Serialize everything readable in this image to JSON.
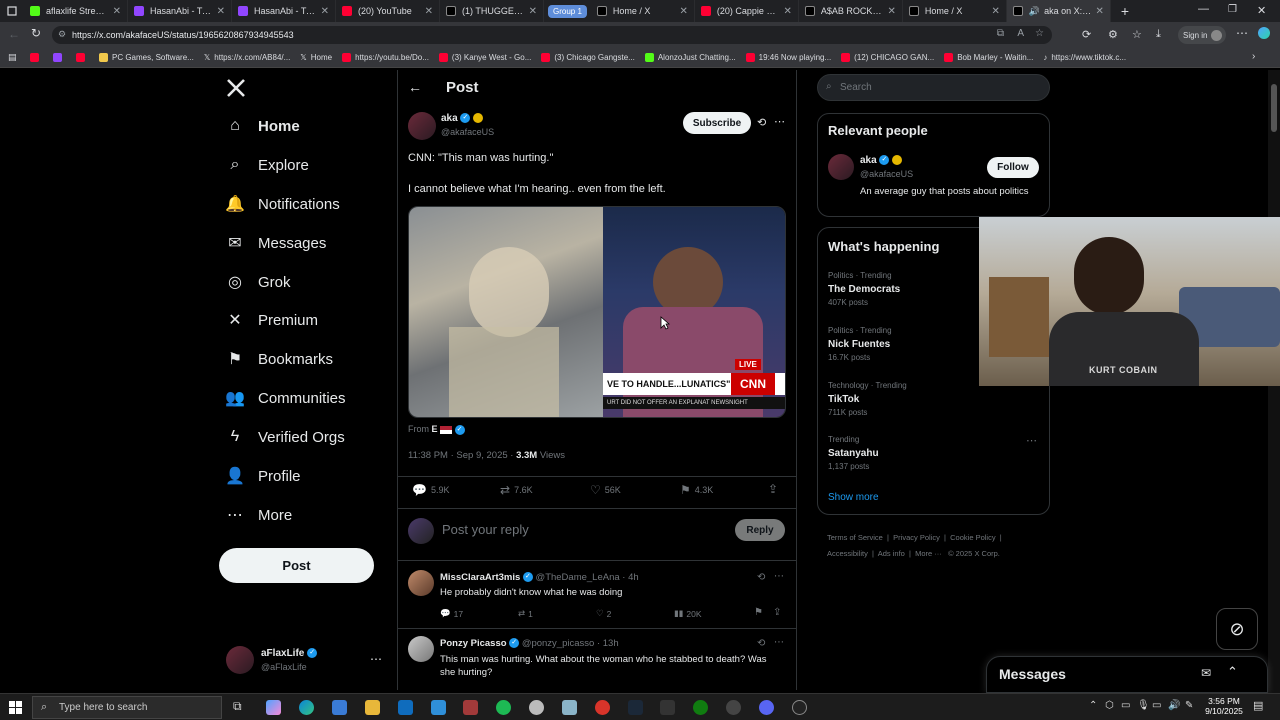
{
  "browser": {
    "tabs": [
      {
        "title": "aflaxlife Stream - V",
        "color": "#53fc18"
      },
      {
        "title": "HasanAbi - Twitch",
        "color": "#9146ff"
      },
      {
        "title": "HasanAbi - Twitch",
        "color": "#9146ff"
      },
      {
        "title": "(20) YouTube",
        "color": "#ff0033"
      },
      {
        "title": "(1) THUGGERDAIL",
        "color": "#e7e9ea"
      },
      {
        "title": "Home / X",
        "color": "#e7e9ea"
      },
      {
        "title": "(20) Cappie Ponde",
        "color": "#ff0033"
      },
      {
        "title": "A$AB ROCKY on X",
        "color": "#e7e9ea"
      },
      {
        "title": "Home / X",
        "color": "#e7e9ea"
      },
      {
        "title": "aka on X: \"CN",
        "color": "#e7e9ea"
      }
    ],
    "group_label": "Group 1",
    "url": "https://x.com/akafaceUS/status/1965620867934945543",
    "sign_in": "Sign in",
    "bookmarks": [
      {
        "label": "",
        "color": "#ff0033"
      },
      {
        "label": "",
        "color": "#9146ff"
      },
      {
        "label": "",
        "color": "#ff0033"
      },
      {
        "label": "PC Games, Software...",
        "color": "#f2c94c"
      },
      {
        "label": "https://x.com/AB84/...",
        "color": "#e7e9ea"
      },
      {
        "label": "Home",
        "color": "#e7e9ea"
      },
      {
        "label": "https://youtu.be/Do...",
        "color": "#ff0033"
      },
      {
        "label": "(3) Kanye West - Go...",
        "color": "#ff0033"
      },
      {
        "label": "(3) Chicago Gangste...",
        "color": "#ff0033"
      },
      {
        "label": "AlonzoJust Chatting...",
        "color": "#53fc18"
      },
      {
        "label": "19:46 Now playing...",
        "color": "#ff0033"
      },
      {
        "label": "(12) CHICAGO GAN...",
        "color": "#ff0033"
      },
      {
        "label": "Bob Marley - Waitin...",
        "color": "#ff0033"
      },
      {
        "label": "https://www.tiktok.c...",
        "color": "#e7e9ea"
      }
    ]
  },
  "nav": {
    "items": [
      {
        "label": "Home",
        "icon": "⌂"
      },
      {
        "label": "Explore",
        "icon": "⌕"
      },
      {
        "label": "Notifications",
        "icon": "🔔"
      },
      {
        "label": "Messages",
        "icon": "✉"
      },
      {
        "label": "Grok",
        "icon": "◎"
      },
      {
        "label": "Premium",
        "icon": "✕"
      },
      {
        "label": "Bookmarks",
        "icon": "⚑"
      },
      {
        "label": "Communities",
        "icon": "👥"
      },
      {
        "label": "Verified Orgs",
        "icon": "ϟ"
      },
      {
        "label": "Profile",
        "icon": "👤"
      },
      {
        "label": "More",
        "icon": "⋯"
      }
    ],
    "post_label": "Post",
    "account": {
      "name": "aFlaxLife",
      "handle": "@aFlaxLife"
    }
  },
  "header": {
    "title": "Post"
  },
  "tweet": {
    "author": "aka",
    "handle": "@akafaceUS",
    "subscribe": "Subscribe",
    "line1": "CNN: \"This man was hurting.\"",
    "line2": "I cannot believe what I'm hearing.. even from the left.",
    "from_label": "From",
    "from_name": "E",
    "time": "11:38 PM · Sep 9, 2025 ·",
    "views_count": "3.3M",
    "views_label": "Views",
    "stats": {
      "replies": "5.9K",
      "reposts": "7.6K",
      "likes": "56K",
      "bookmarks": "4.3K"
    },
    "media": {
      "live": "LIVE",
      "cnn": "CNN",
      "chyron": "VE TO HANDLE...LUNATICS\"",
      "subchyron": "URT DID NOT OFFER AN EXPLANAT NEWSNIGHT"
    }
  },
  "reply_box": {
    "placeholder": "Post your reply",
    "button": "Reply"
  },
  "replies": [
    {
      "name": "MissClaraArt3mis",
      "handle": "@TheDame_LeAna",
      "time": "· 4h",
      "text": "He probably didn't know what he was doing",
      "replies": "17",
      "reposts": "1",
      "likes": "2",
      "views": "20K"
    },
    {
      "name": "Ponzy Picasso",
      "handle": "@ponzy_picasso",
      "time": "· 13h",
      "text": "This man was hurting. What about the woman who he stabbed to death? Was she hurting?"
    }
  ],
  "search": {
    "placeholder": "Search"
  },
  "relevant": {
    "title": "Relevant people",
    "name": "aka",
    "handle": "@akafaceUS",
    "bio": "An average guy that posts about politics",
    "follow": "Follow"
  },
  "happening": {
    "title": "What's happening",
    "trends": [
      {
        "cat": "Politics · Trending",
        "name": "The Democrats",
        "count": "407K posts"
      },
      {
        "cat": "Politics · Trending",
        "name": "Nick Fuentes",
        "count": "16.7K posts"
      },
      {
        "cat": "Technology · Trending",
        "name": "TikTok",
        "count": "711K posts"
      },
      {
        "cat": "Trending",
        "name": "Satanyahu",
        "count": "1,137 posts"
      }
    ],
    "show_more": "Show more"
  },
  "footer_links": [
    "Terms of Service",
    "Privacy Policy",
    "Cookie Policy",
    "Accessibility",
    "Ads info",
    "More ···",
    "© 2025 X Corp."
  ],
  "webcam": {
    "shirt_text": "KURT COBAIN"
  },
  "messages_drawer": {
    "title": "Messages"
  },
  "taskbar": {
    "search": "Type here to search",
    "time": "3:56 PM",
    "date": "9/10/2025"
  }
}
